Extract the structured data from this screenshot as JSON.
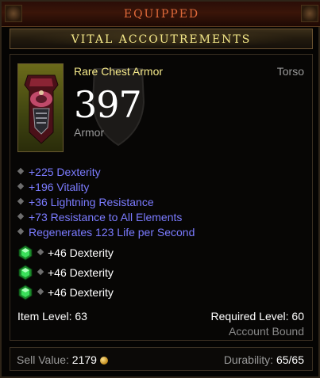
{
  "header": {
    "status_label": "EQUIPPED"
  },
  "item": {
    "name": "VITAL ACCOUTREMENTS",
    "type": "Rare Chest Armor",
    "slot": "Torso",
    "armor_value": "397",
    "armor_label": "Armor",
    "affixes": [
      "+225 Dexterity",
      "+196 Vitality",
      "+36 Lightning Resistance",
      "+73 Resistance to All Elements",
      "Regenerates 123 Life per Second"
    ],
    "sockets": [
      {
        "gem": "emerald-gem-icon",
        "text": "+46 Dexterity"
      },
      {
        "gem": "emerald-gem-icon",
        "text": "+46 Dexterity"
      },
      {
        "gem": "emerald-gem-icon",
        "text": "+46 Dexterity"
      }
    ],
    "item_level": "Item Level: 63",
    "required_level": "Required Level: 60",
    "binding": "Account Bound"
  },
  "footer": {
    "sell_label": "Sell Value:",
    "sell_value": "2179",
    "durability_label": "Durability:",
    "durability_value": "65/65"
  },
  "colors": {
    "rare_name": "#f5e98a",
    "affix_blue": "#7b7bff",
    "equipped_orange": "#e06a3a",
    "gem_green": "#2fd84a"
  }
}
